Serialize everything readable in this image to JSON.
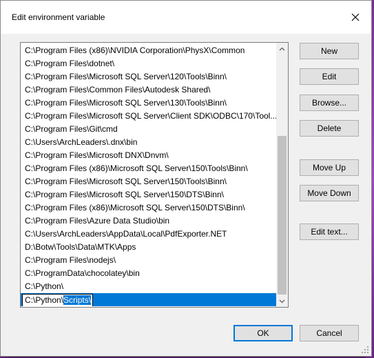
{
  "window": {
    "title": "Edit environment variable"
  },
  "list": {
    "items": [
      "C:\\Program Files (x86)\\NVIDIA Corporation\\PhysX\\Common",
      "C:\\Program Files\\dotnet\\",
      "C:\\Program Files\\Microsoft SQL Server\\120\\Tools\\Binn\\",
      "C:\\Program Files\\Common Files\\Autodesk Shared\\",
      "C:\\Program Files\\Microsoft SQL Server\\130\\Tools\\Binn\\",
      "C:\\Program Files\\Microsoft SQL Server\\Client SDK\\ODBC\\170\\Tool...",
      "C:\\Program Files\\Git\\cmd",
      "C:\\Users\\ArchLeaders\\.dnx\\bin",
      "C:\\Program Files\\Microsoft DNX\\Dnvm\\",
      "C:\\Program Files (x86)\\Microsoft SQL Server\\150\\Tools\\Binn\\",
      "C:\\Program Files\\Microsoft SQL Server\\150\\Tools\\Binn\\",
      "C:\\Program Files\\Microsoft SQL Server\\150\\DTS\\Binn\\",
      "C:\\Program Files (x86)\\Microsoft SQL Server\\150\\DTS\\Binn\\",
      "C:\\Program Files\\Azure Data Studio\\bin",
      "C:\\Users\\ArchLeaders\\AppData\\Local\\PdfExporter.NET",
      "D:\\Botw\\Tools\\Data\\MTK\\Apps",
      "C:\\Program Files\\nodejs\\",
      "C:\\ProgramData\\chocolatey\\bin",
      "C:\\Python\\"
    ],
    "editing": {
      "prefix": "C:\\Python\\",
      "selected": "Scripts\\"
    }
  },
  "buttons": {
    "new": "New",
    "edit": "Edit",
    "browse": "Browse...",
    "delete": "Delete",
    "move_up": "Move Up",
    "move_down": "Move Down",
    "edit_text": "Edit text...",
    "ok": "OK",
    "cancel": "Cancel"
  },
  "colors": {
    "accent": "#0078d7",
    "dialog_bg": "#f0f0f0",
    "desktop_bg": "#4a1a5e"
  }
}
